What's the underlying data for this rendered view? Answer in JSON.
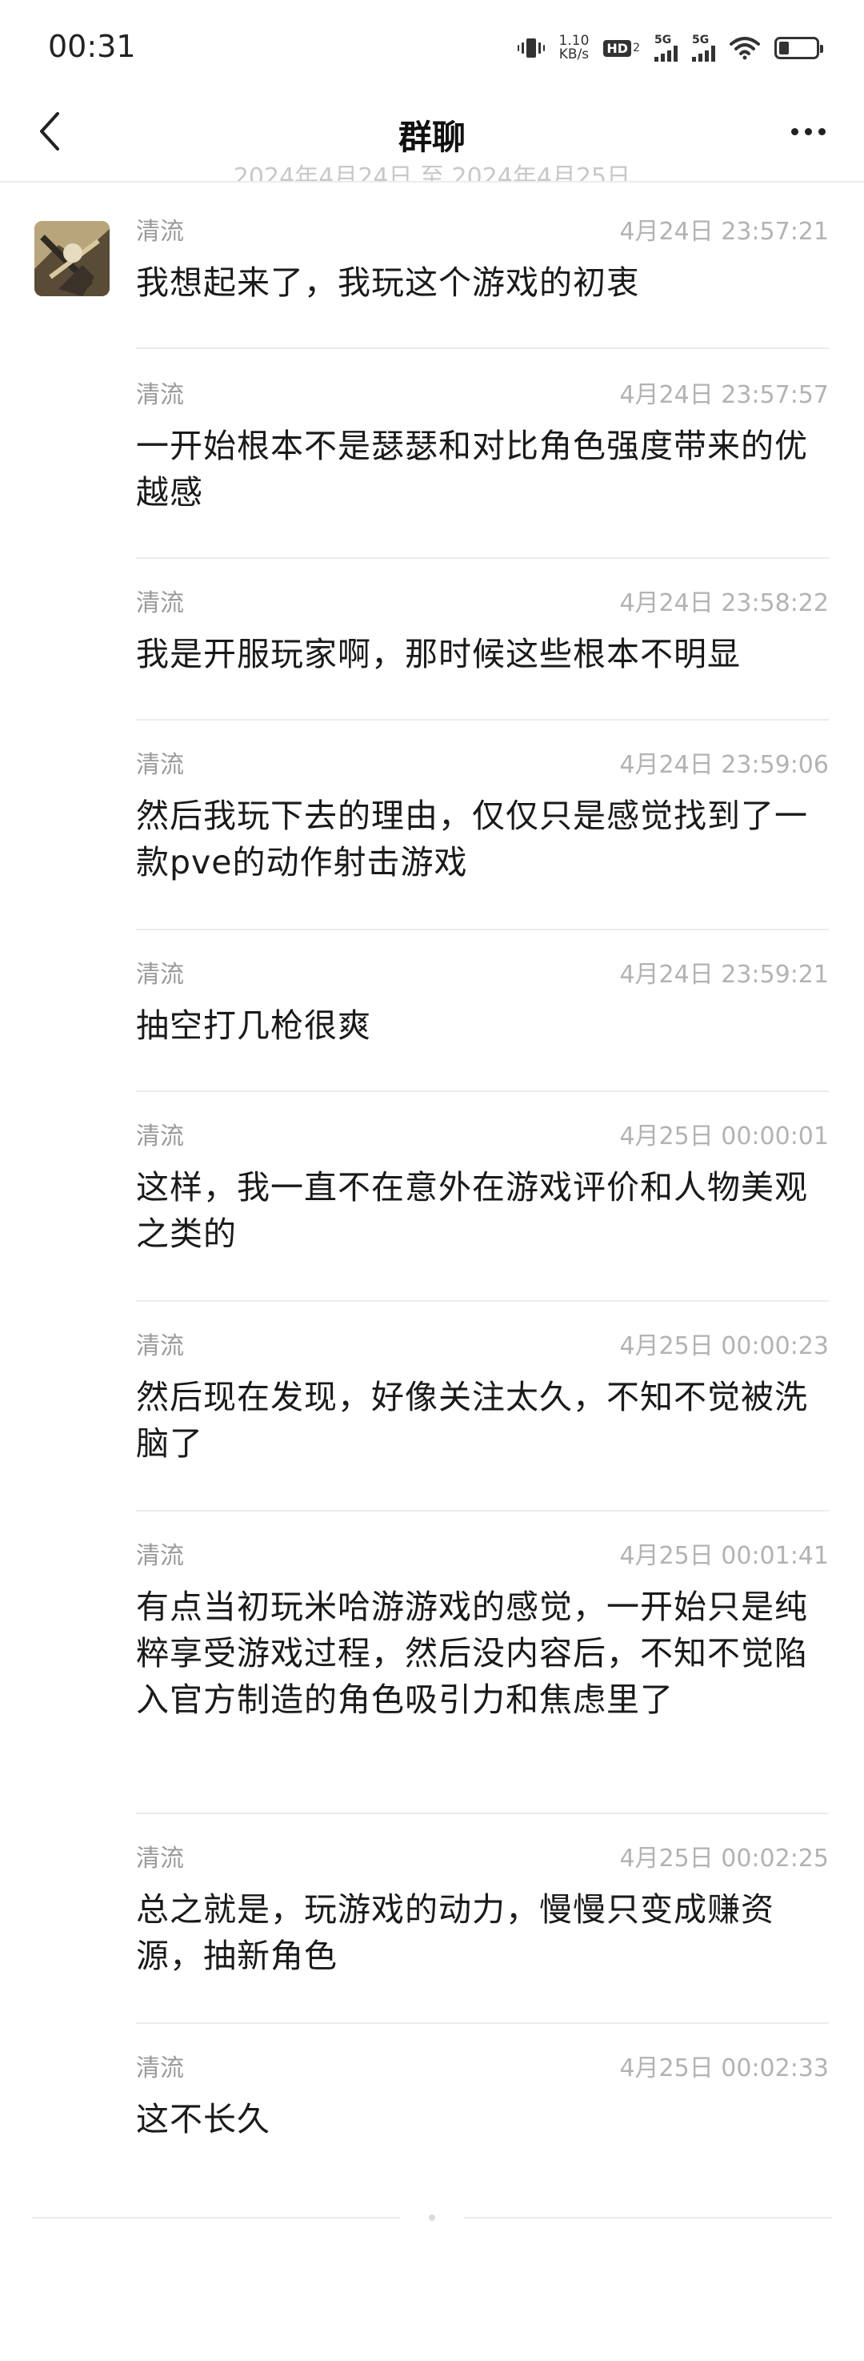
{
  "status_bar": {
    "time": "00:31",
    "speed_value": "1.10",
    "speed_unit": "KB/s",
    "hd_label": "HD",
    "hd_sub": "2",
    "sim1_label": "5G",
    "sim2_label": "5G",
    "icons": [
      "vibrate-icon",
      "wifi-icon",
      "battery-icon"
    ]
  },
  "nav": {
    "title": "群聊",
    "back_icon": "chevron-left-icon",
    "more_icon": "more-dots-icon"
  },
  "date_range_peek": "2024年4月24日 至 2024年4月25日",
  "messages": [
    {
      "sender": "清流",
      "time": "4月24日 23:57:21",
      "text": "我想起来了，我玩这个游戏的初衷"
    },
    {
      "sender": "清流",
      "time": "4月24日 23:57:57",
      "text": "一开始根本不是瑟瑟和对比角色强度带来的优越感"
    },
    {
      "sender": "清流",
      "time": "4月24日 23:58:22",
      "text": "我是开服玩家啊，那时候这些根本不明显"
    },
    {
      "sender": "清流",
      "time": "4月24日 23:59:06",
      "text": "然后我玩下去的理由，仅仅只是感觉找到了一款pve的动作射击游戏"
    },
    {
      "sender": "清流",
      "time": "4月24日 23:59:21",
      "text": "抽空打几枪很爽"
    },
    {
      "sender": "清流",
      "time": "4月25日 00:00:01",
      "text": "这样，我一直不在意外在游戏评价和人物美观之类的"
    },
    {
      "sender": "清流",
      "time": "4月25日 00:00:23",
      "text": "然后现在发现，好像关注太久，不知不觉被洗脑了"
    },
    {
      "sender": "清流",
      "time": "4月25日 00:01:41",
      "text": "有点当初玩米哈游游戏的感觉，一开始只是纯粹享受游戏过程，然后没内容后，不知不觉陷入官方制造的角色吸引力和焦虑里了"
    },
    {
      "sender": "清流",
      "time": "4月25日 00:02:25",
      "text": "总之就是，玩游戏的动力，慢慢只变成赚资源，抽新角色"
    },
    {
      "sender": "清流",
      "time": "4月25日 00:02:33",
      "text": "这不长久"
    }
  ]
}
